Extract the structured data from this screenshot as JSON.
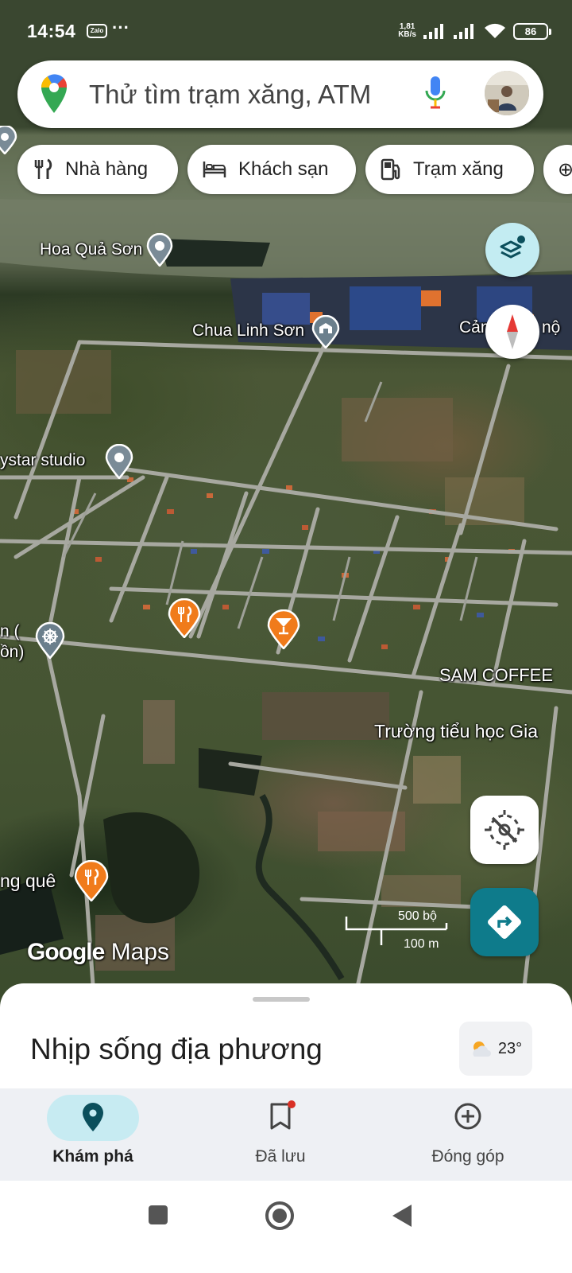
{
  "status_bar": {
    "time": "14:54",
    "zalo_badge": "Zalo",
    "more_notifications": "···",
    "net_speed_value": "1,81",
    "net_speed_unit": "KB/s",
    "battery": "86"
  },
  "search": {
    "placeholder": "Thử tìm trạm xăng, ATM"
  },
  "chips": [
    {
      "label": "Nhà hàng",
      "icon": "restaurant-icon"
    },
    {
      "label": "Khách sạn",
      "icon": "hotel-icon"
    },
    {
      "label": "Trạm xăng",
      "icon": "gas-station-icon"
    }
  ],
  "map": {
    "labels": {
      "hoa_qua_son": "Hoa Quả Sơn",
      "chua_linh_son": "Chua Linh Sơn",
      "cang": "Cảng",
      "cang_suffix": "nộ",
      "skystar": "ystar studio",
      "left_partial_1": "n (",
      "left_partial_2": "ồn)",
      "sam_coffee": "SAM COFFEE",
      "truong_tieu_hoc": "Trường tiểu học Gia",
      "lang_que": "ng quê"
    },
    "scale_imperial": "500 bộ",
    "scale_metric": "100 m",
    "watermark_google": "Google",
    "watermark_maps": "Maps"
  },
  "colors": {
    "accent_teal": "#0e7b8b",
    "restaurant_pin": "#f07b1b",
    "place_pin": "#6b7f8c",
    "nav_active_pill": "#c7ebf2",
    "nav_active_icon": "#0b4f5c"
  },
  "sheet": {
    "title": "Nhịp sống địa phương",
    "weather_temp": "23°",
    "weather_icon": "partly-sunny-icon"
  },
  "nav": {
    "items": [
      {
        "label": "Khám phá",
        "icon": "explore-pin-icon",
        "active": true
      },
      {
        "label": "Đã lưu",
        "icon": "bookmark-icon",
        "active": false,
        "badge": true
      },
      {
        "label": "Đóng góp",
        "icon": "add-circle-icon",
        "active": false
      }
    ]
  }
}
